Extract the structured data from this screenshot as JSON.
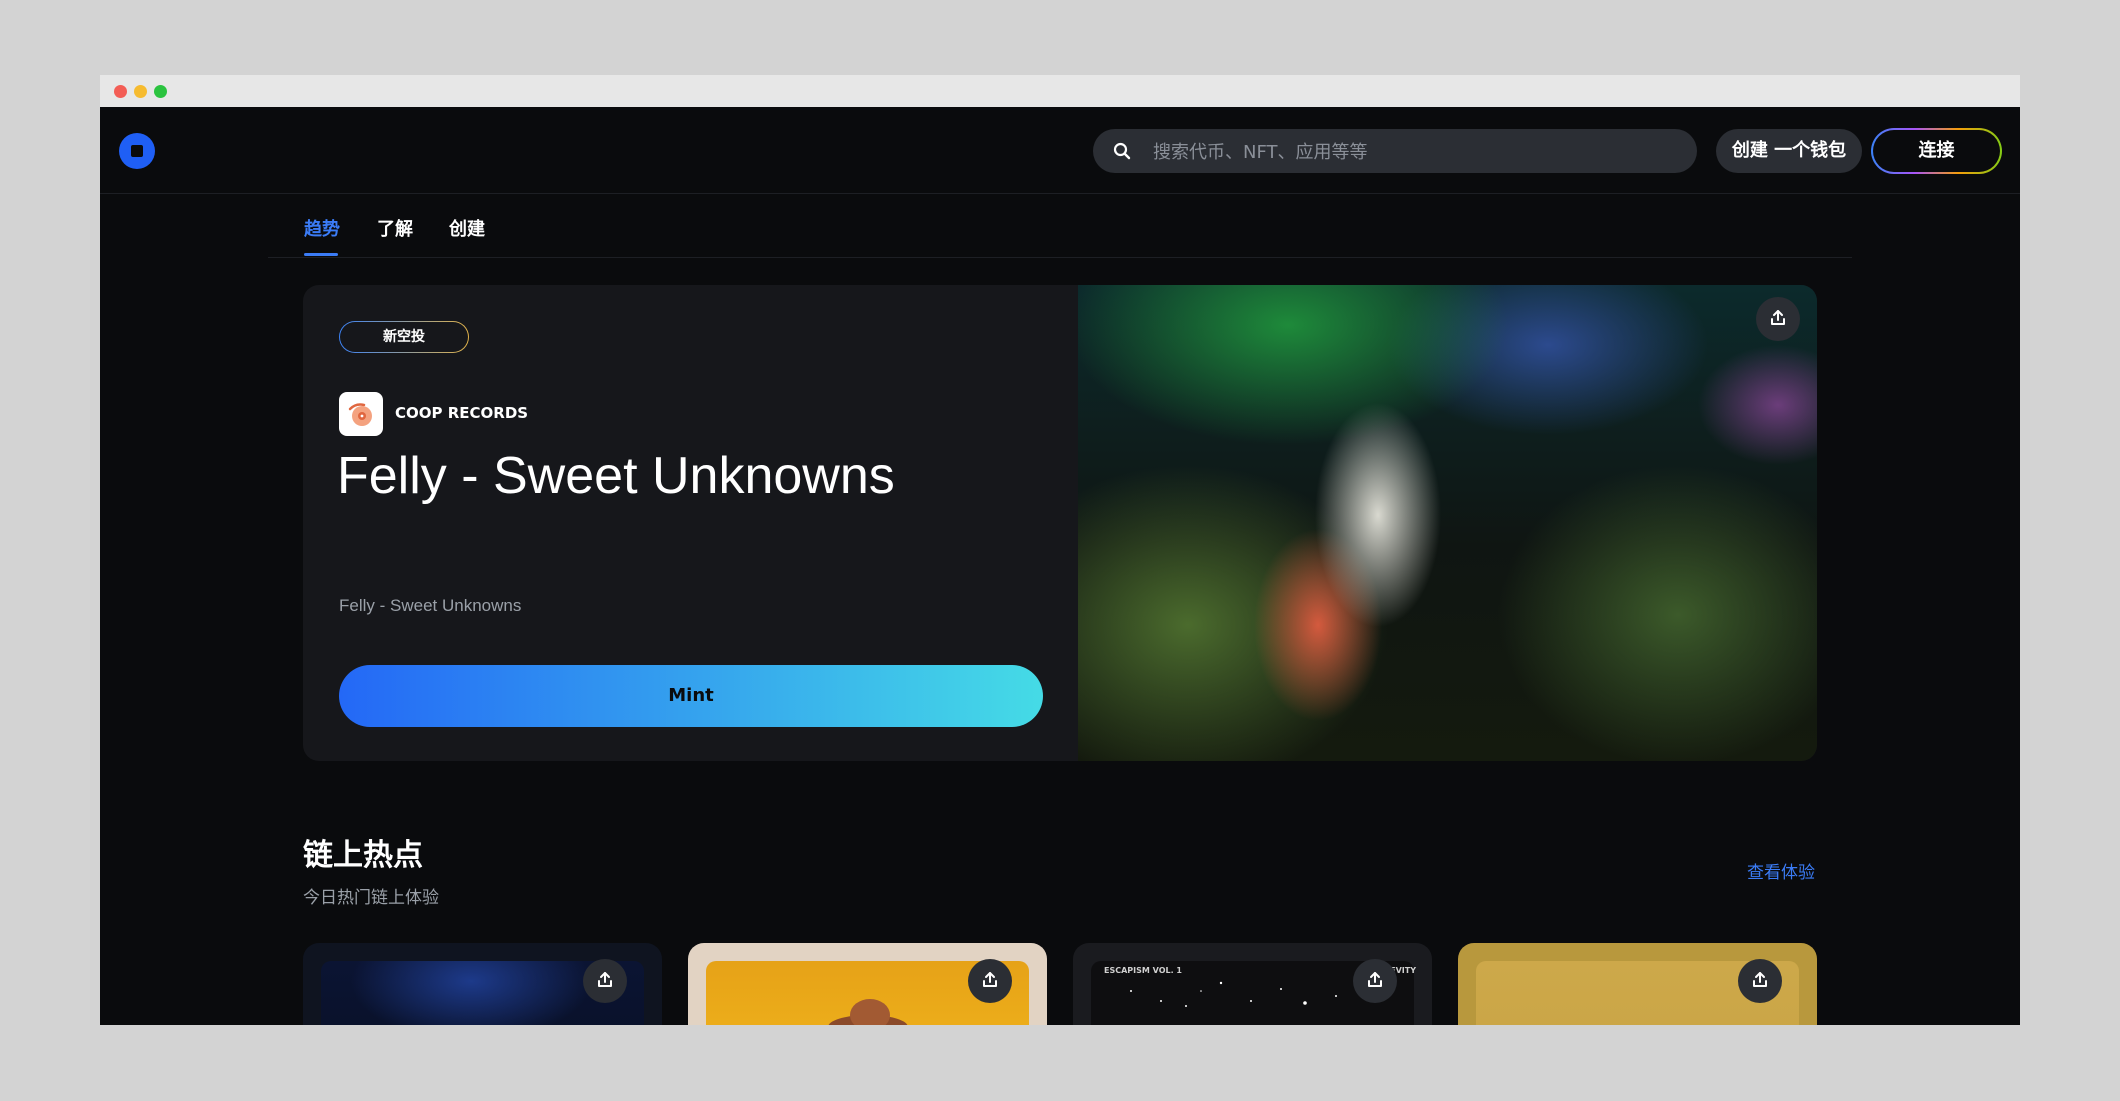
{
  "window": {
    "controls": [
      "close",
      "minimize",
      "zoom"
    ]
  },
  "header": {
    "logo": "coinbase-logo",
    "search": {
      "placeholder": "搜索代币、NFT、应用等等",
      "value": ""
    },
    "create_wallet_label": "创建 一个钱包",
    "connect_label": "连接"
  },
  "tabs": [
    {
      "label": "趋势",
      "active": true
    },
    {
      "label": "了解",
      "active": false
    },
    {
      "label": "创建",
      "active": false
    }
  ],
  "featured": {
    "badge": "新空投",
    "creator": "COOP RECORDS",
    "title": "Felly - Sweet Unknowns",
    "subtitle": "Felly - Sweet Unknowns",
    "mint_label": "Mint"
  },
  "onchain": {
    "title": "链上热点",
    "subtitle": "今日热门链上体验",
    "view_label": "查看体验",
    "cards": [
      {
        "top_left": "",
        "top_right": ""
      },
      {
        "top_left": "",
        "top_right": ""
      },
      {
        "top_left": "ESCAPISM VOL. 1",
        "top_right": "LEVITY"
      },
      {
        "top_left": "",
        "top_right": ""
      }
    ]
  },
  "colors": {
    "accent": "#3b7cf6",
    "background": "#0a0b0d",
    "surface": "#16171b",
    "mint_gradient_start": "#2468f6",
    "mint_gradient_end": "#45dbe6"
  }
}
